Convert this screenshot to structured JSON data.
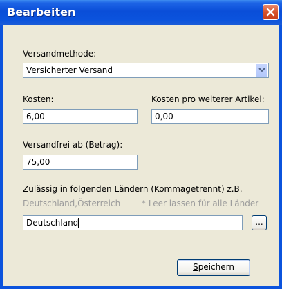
{
  "window": {
    "title": "Bearbeiten"
  },
  "form": {
    "shipping_method_label": "Versandmethode:",
    "shipping_method_value": "Versicherter Versand",
    "cost_label": "Kosten:",
    "cost_value": "6,00",
    "cost_additional_label": "Kosten pro weiterer Artikel:",
    "cost_additional_value": "0,00",
    "free_shipping_label": "Versandfrei ab (Betrag):",
    "free_shipping_value": "75,00",
    "countries_label": "Zulässig in folgenden Ländern (Kommagetrennt) z.B.",
    "countries_example": "Deutschland,Österreich",
    "countries_hint": "* Leer lassen für alle Länder",
    "countries_value": "Deutschland",
    "browse_label": "...",
    "save_mnemonic": "S",
    "save_rest": "peichern"
  },
  "colors": {
    "titlebar": "#0b53dd",
    "window_bg": "#ece9d8",
    "field_border": "#7f9db9",
    "hint_text": "#9c9c9c",
    "close_button": "#d8532b"
  },
  "icons": {
    "close": "close-x-icon",
    "dropdown": "chevron-down-icon"
  }
}
